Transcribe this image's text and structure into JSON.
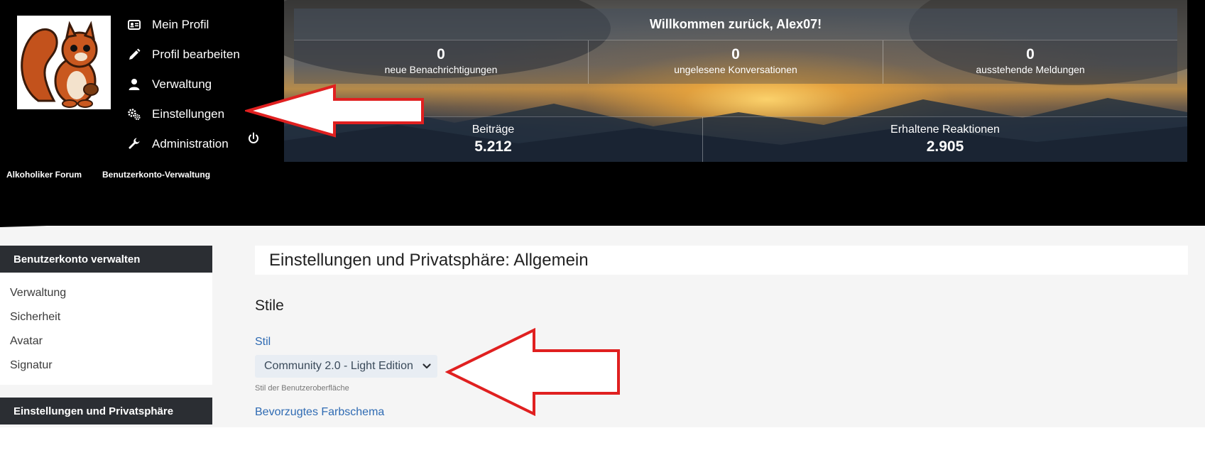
{
  "usermenu": {
    "items": [
      {
        "label": "Mein Profil",
        "icon": "id-card-icon"
      },
      {
        "label": "Profil bearbeiten",
        "icon": "pencil-icon"
      },
      {
        "label": "Verwaltung",
        "icon": "user-icon"
      },
      {
        "label": "Einstellungen",
        "icon": "gears-icon"
      },
      {
        "label": "Administration",
        "icon": "wrench-icon"
      }
    ],
    "logout_icon": "power-icon"
  },
  "banner": {
    "welcome": "Willkommen zurück, Alex07!",
    "stats": [
      {
        "value": "0",
        "label": "neue Benachrichtigungen"
      },
      {
        "value": "0",
        "label": "ungelesene Konversationen"
      },
      {
        "value": "0",
        "label": "ausstehende Meldungen"
      }
    ],
    "stats2": [
      {
        "label": "Beiträge",
        "value": "5.212"
      },
      {
        "label": "Erhaltene Reaktionen",
        "value": "2.905"
      }
    ]
  },
  "breadcrumb": [
    "Alkoholiker Forum",
    "Benutzerkonto-Verwaltung"
  ],
  "sidebar": {
    "section1": {
      "title": "Benutzerkonto verwalten",
      "items": [
        "Verwaltung",
        "Sicherheit",
        "Avatar",
        "Signatur"
      ]
    },
    "section2": {
      "title": "Einstellungen und Privatsphäre"
    }
  },
  "main": {
    "title": "Einstellungen und Privatsphäre: Allgemein",
    "section": "Stile",
    "style_label": "Stil",
    "style_value": "Community 2.0 - Light Edition",
    "style_hint": "Stil der Benutzeroberfläche",
    "color_scheme_label": "Bevorzugtes Farbschema"
  },
  "colors": {
    "arrow_outline": "#e02020",
    "sidebar_header": "#2b2e33",
    "link_blue": "#2f6bb3"
  }
}
